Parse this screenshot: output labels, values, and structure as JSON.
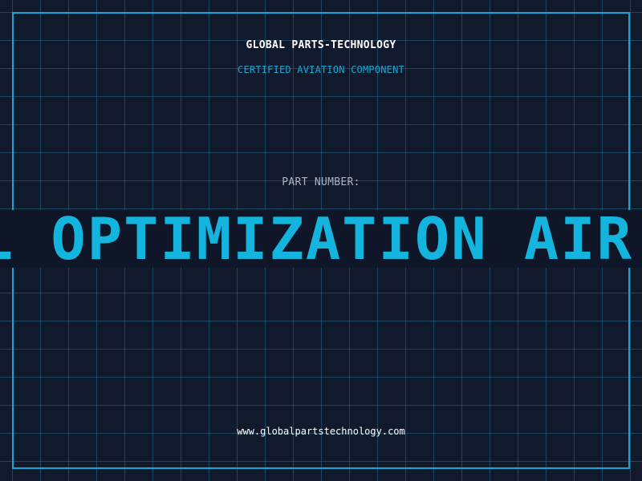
{
  "header": {
    "company": "GLOBAL PARTS-TECHNOLOGY",
    "tagline": "CERTIFIED AVIATION COMPONENT"
  },
  "part": {
    "label": "PART NUMBER:",
    "value": "PAL OPTIMIZATION AIR"
  },
  "footer": {
    "website": "www.globalpartstechnology.com"
  },
  "colors": {
    "background": "#111a2d",
    "grid": "#236e87",
    "accent": "#13b4dd",
    "text": "#ffffff"
  }
}
